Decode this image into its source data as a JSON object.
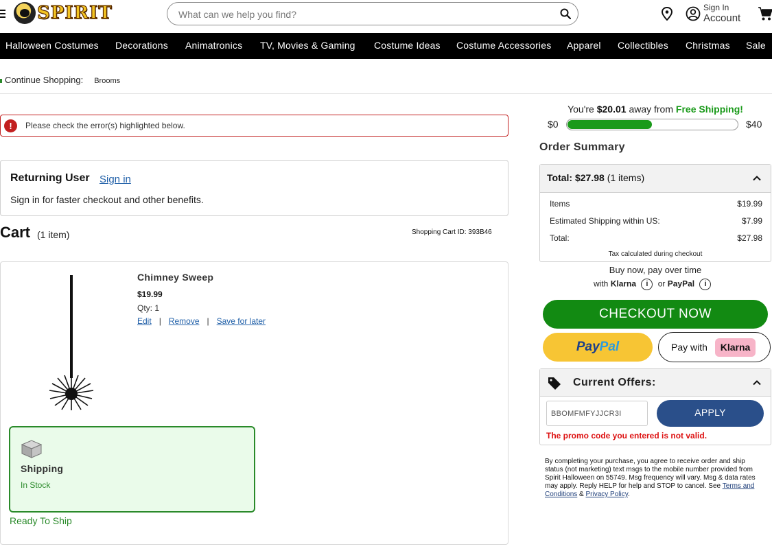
{
  "header": {
    "logo_text": "SPIRIT",
    "search_placeholder": "What can we help you find?",
    "account_line1": "Sign In",
    "account_line2": "Account"
  },
  "nav": {
    "items": [
      "Halloween Costumes",
      "Decorations",
      "Animatronics",
      "TV, Movies & Gaming",
      "Costume Ideas",
      "Costume Accessories",
      "Apparel",
      "Collectibles",
      "Christmas",
      "Sale"
    ]
  },
  "breadcrumb": {
    "label": "Continue Shopping:",
    "link": "Brooms"
  },
  "error": {
    "icon": "!",
    "message": "Please check the error(s) highlighted below."
  },
  "returning_user": {
    "title": "Returning User",
    "sign_in": "Sign in",
    "subtitle": "Sign in for faster checkout and other benefits."
  },
  "cart": {
    "title": "Cart",
    "count": "(1 item)",
    "cart_id": "Shopping Cart ID: 393B46",
    "item": {
      "name": "Chimney Sweep",
      "price": "$19.99",
      "qty": "Qty: 1",
      "edit": "Edit",
      "remove": "Remove",
      "save_later": "Save for later",
      "sep": "|"
    },
    "shipping": {
      "title": "Shipping",
      "stock": "In Stock",
      "ready": "Ready To Ship"
    }
  },
  "free_shipping": {
    "prefix": "You're",
    "amount": "$20.01",
    "middle": "away from",
    "label": "Free Shipping!",
    "min": "$0",
    "max": "$40",
    "progress_fraction": 0.4997
  },
  "order_summary": {
    "heading": "Order Summary",
    "total_label": "Total:",
    "total_value": "$27.98",
    "total_items": "(1 items)",
    "rows": [
      {
        "label": "Items",
        "value": "$19.99"
      },
      {
        "label": "Estimated Shipping within US:",
        "value": "$7.99"
      },
      {
        "label": "Total:",
        "value": "$27.98"
      }
    ],
    "tax_note": "Tax calculated during checkout"
  },
  "bnpl": {
    "line1": "Buy now, pay over time",
    "with": "with",
    "klarna": "Klarna",
    "or": "or",
    "paypal": "PayPal",
    "info": "i"
  },
  "buttons": {
    "checkout": "CHECKOUT NOW",
    "paypal_a": "Pay",
    "paypal_b": "Pal",
    "pay_with": "Pay with",
    "klarna": "Klarna"
  },
  "offers": {
    "title": "Current Offers:",
    "promo_value": "BBOMFMFYJJCR3I",
    "apply": "APPLY",
    "error": "The promo code you entered is not valid."
  },
  "legal": {
    "text": "By completing your purchase, you agree to receive order and ship status (not marketing) text msgs to the mobile number provided from Spirit Halloween on 55749. Msg frequency will vary. Msg & data rates may apply. Reply HELP for help and STOP to cancel. See",
    "terms": "Terms and Conditions",
    "amp": "&",
    "privacy": "Privacy Policy",
    "end": "."
  },
  "colors": {
    "accent_green": "#1a9a1a",
    "error_red": "#c21f1f",
    "link_blue": "#1f5fa8",
    "apply_blue": "#2a4f8a",
    "paypal_yellow": "#f7c534",
    "klarna_pink": "#f7b4c8"
  },
  "icons": [
    "hamburger-icon",
    "search-icon",
    "location-icon",
    "account-icon",
    "cart-icon",
    "error-icon",
    "box-icon",
    "tag-icon",
    "chevron-up-icon",
    "info-icon"
  ]
}
